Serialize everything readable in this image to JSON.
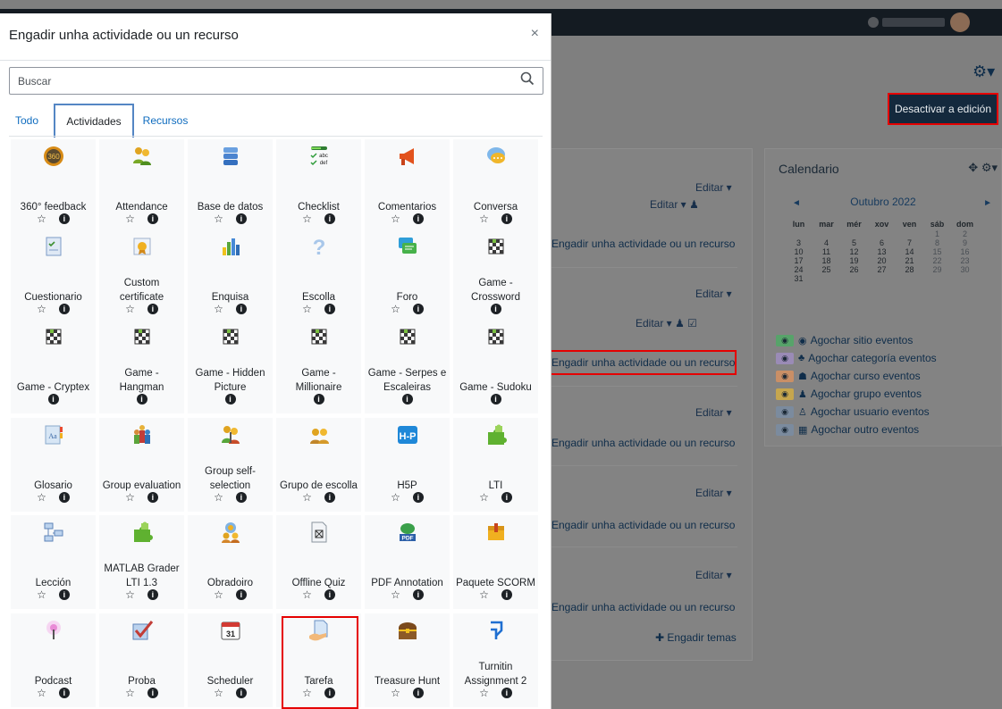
{
  "modal": {
    "title": "Engadir unha actividade ou un recurso",
    "close": "×",
    "search_placeholder": "Buscar",
    "tabs": [
      "Todo",
      "Actividades",
      "Recursos"
    ],
    "items": [
      {
        "label": "360° feedback",
        "icon": "feedback360-icon",
        "star": true
      },
      {
        "label": "Attendance",
        "icon": "attendance-icon",
        "star": true
      },
      {
        "label": "Base de datos",
        "icon": "database-icon",
        "star": true
      },
      {
        "label": "Checklist",
        "icon": "checklist-icon",
        "star": true
      },
      {
        "label": "Comentarios",
        "icon": "megaphone-icon",
        "star": true
      },
      {
        "label": "Conversa",
        "icon": "chat-icon",
        "star": true
      },
      {
        "label": "Cuestionario",
        "icon": "quiz-icon",
        "star": true
      },
      {
        "label": "Custom certificate",
        "icon": "certificate-icon",
        "star": true
      },
      {
        "label": "Enquisa",
        "icon": "survey-chart-icon",
        "star": true
      },
      {
        "label": "Escolla",
        "icon": "question-icon",
        "star": true
      },
      {
        "label": "Foro",
        "icon": "forum-icon",
        "star": true
      },
      {
        "label": "Game - Crossword",
        "icon": "game-board-icon",
        "star": false
      },
      {
        "label": "Game - Cryptex",
        "icon": "game-board-icon",
        "star": false
      },
      {
        "label": "Game - Hangman",
        "icon": "game-board-icon",
        "star": false
      },
      {
        "label": "Game - Hidden Picture",
        "icon": "game-board-icon",
        "star": false
      },
      {
        "label": "Game - Millionaire",
        "icon": "game-board-icon",
        "star": false
      },
      {
        "label": "Game - Serpes e Escaleiras",
        "icon": "game-board-icon",
        "star": false
      },
      {
        "label": "Game - Sudoku",
        "icon": "game-board-icon",
        "star": false
      },
      {
        "label": "Glosario",
        "icon": "glossary-icon",
        "star": true
      },
      {
        "label": "Group evaluation",
        "icon": "group-evaluation-icon",
        "star": true
      },
      {
        "label": "Group self-selection",
        "icon": "group-selection-icon",
        "star": true
      },
      {
        "label": "Grupo de escolla",
        "icon": "group-choice-icon",
        "star": true
      },
      {
        "label": "H5P",
        "icon": "h5p-icon",
        "star": true
      },
      {
        "label": "LTI",
        "icon": "puzzle-icon",
        "star": true
      },
      {
        "label": "Lección",
        "icon": "lesson-icon",
        "star": true
      },
      {
        "label": "MATLAB Grader LTI 1.3",
        "icon": "puzzle-icon",
        "star": true
      },
      {
        "label": "Obradoiro",
        "icon": "workshop-icon",
        "star": true
      },
      {
        "label": "Offline Quiz",
        "icon": "offline-quiz-icon",
        "star": true
      },
      {
        "label": "PDF Annotation",
        "icon": "pdf-icon",
        "star": true
      },
      {
        "label": "Paquete SCORM",
        "icon": "scorm-package-icon",
        "star": true
      },
      {
        "label": "Podcast",
        "icon": "podcast-icon",
        "star": true
      },
      {
        "label": "Proba",
        "icon": "checkmark-icon",
        "star": true
      },
      {
        "label": "Scheduler",
        "icon": "calendar-31-icon",
        "star": true
      },
      {
        "label": "Tarefa",
        "icon": "assignment-icon",
        "star": true
      },
      {
        "label": "Treasure Hunt",
        "icon": "treasure-chest-icon",
        "star": true
      },
      {
        "label": "Turnitin Assignment 2",
        "icon": "turnitin-icon",
        "star": true
      }
    ]
  },
  "background": {
    "edit_button": "Desactivar a edición",
    "editar": "Editar ▾",
    "add_activity": "Engadir unha actividade ou un recurso",
    "add_topics": "Engadir temas",
    "calendar": {
      "title": "Calendario",
      "month": "Outubro 2022",
      "weekdays": [
        "lun",
        "mar",
        "mér",
        "xov",
        "ven",
        "sáb",
        "dom"
      ],
      "weeks": [
        [
          "",
          "",
          "",
          "",
          "",
          "1",
          "2"
        ],
        [
          "3",
          "4",
          "5",
          "6",
          "7",
          "8",
          "9"
        ],
        [
          "10",
          "11",
          "12",
          "13",
          "14",
          "15",
          "16"
        ],
        [
          "17",
          "18",
          "19",
          "20",
          "21",
          "22",
          "23"
        ],
        [
          "24",
          "25",
          "26",
          "27",
          "28",
          "29",
          "30"
        ],
        [
          "31",
          "",
          "",
          "",
          "",
          "",
          ""
        ]
      ],
      "filters": [
        {
          "label": "Agochar sitio eventos",
          "color": "#57a36a",
          "icon": "globe-icon"
        },
        {
          "label": "Agochar categoría eventos",
          "color": "#9a8bb6",
          "icon": "category-icon"
        },
        {
          "label": "Agochar curso eventos",
          "color": "#c98f66",
          "icon": "graduation-cap-icon"
        },
        {
          "label": "Agochar grupo eventos",
          "color": "#c6a64e",
          "icon": "group-icon"
        },
        {
          "label": "Agochar usuario eventos",
          "color": "#7b8b9e",
          "icon": "user-icon"
        },
        {
          "label": "Agochar outro eventos",
          "color": "#7b8b9e",
          "icon": "calendar-icon"
        }
      ]
    }
  }
}
